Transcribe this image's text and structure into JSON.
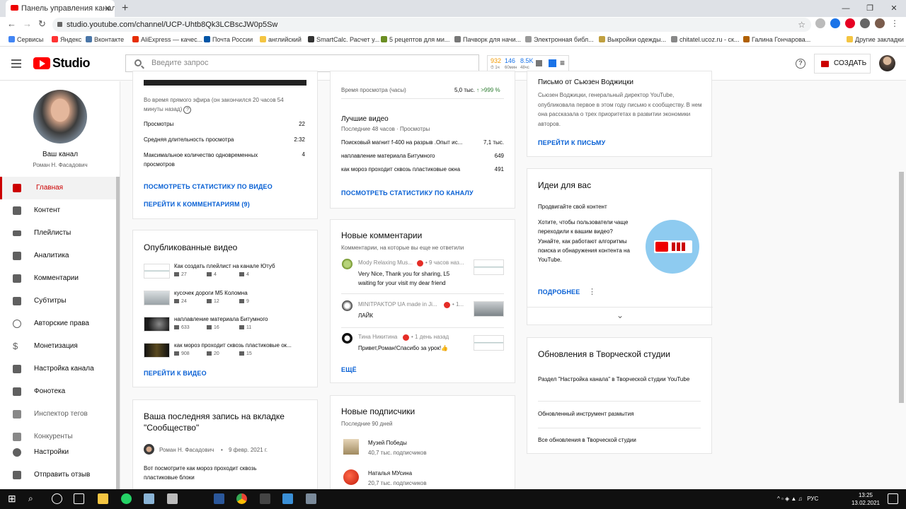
{
  "browser": {
    "tab_title": "Панель управления каналом - ",
    "tab_close": "✕",
    "new_tab": "+",
    "url": "studio.youtube.com/channel/UCP-Uhtb8Qk3LCBscJW0p5Sw",
    "window_controls": [
      "—",
      "❐",
      "✕"
    ],
    "bookmarks": [
      {
        "label": "Сервисы",
        "color": "#4285f4"
      },
      {
        "label": "Яндекс",
        "color": "#f33"
      },
      {
        "label": "Вконтакте",
        "color": "#4a76a8"
      },
      {
        "label": "AliExpress — качес...",
        "color": "#e62e04"
      },
      {
        "label": "Почта России",
        "color": "#0055a6"
      },
      {
        "label": "английский",
        "color": "#f4c542"
      },
      {
        "label": "SmartCalc. Расчет у...",
        "color": "#333"
      },
      {
        "label": "5 рецептов для ми...",
        "color": "#6b8e23"
      },
      {
        "label": "Пачворк для начи...",
        "color": "#777"
      },
      {
        "label": "Электронная библ...",
        "color": "#999"
      },
      {
        "label": "Выкройки одежды...",
        "color": "#c0a040"
      },
      {
        "label": "chitatel.ucoz.ru - ск...",
        "color": "#888"
      },
      {
        "label": "Галина Гончарова...",
        "color": "#b06000"
      },
      {
        "label": "Другие закладки",
        "color": "#f4c542"
      }
    ]
  },
  "header": {
    "logo_text": "Studio",
    "search_placeholder": "Введите запрос",
    "counters": [
      {
        "value": "932",
        "sub": "⏱ 1ч",
        "color": "#f29900"
      },
      {
        "value": "146",
        "sub": "60мин",
        "color": "#1a73e8"
      },
      {
        "value": "8.5K",
        "sub": "48чс",
        "color": "#1a73e8"
      }
    ],
    "help_icon": "?",
    "create_label": "СОЗДАТЬ"
  },
  "sidebar": {
    "channel_title": "Ваш канал",
    "channel_owner": "Роман Н. Фасадович",
    "items": [
      {
        "label": "Главная",
        "icon": "dashboard-icon",
        "active": true
      },
      {
        "label": "Контент",
        "icon": "content-icon"
      },
      {
        "label": "Плейлисты",
        "icon": "playlists-icon"
      },
      {
        "label": "Аналитика",
        "icon": "analytics-icon"
      },
      {
        "label": "Комментарии",
        "icon": "comments-icon"
      },
      {
        "label": "Субтитры",
        "icon": "subtitles-icon"
      },
      {
        "label": "Авторские права",
        "icon": "copyright-icon"
      },
      {
        "label": "Монетизация",
        "icon": "monetization-icon"
      },
      {
        "label": "Настройка канала",
        "icon": "customization-icon"
      },
      {
        "label": "Фонотека",
        "icon": "audio-library-icon"
      },
      {
        "label": "Инспектор тегов",
        "icon": "tag-inspector-icon",
        "grey": true
      },
      {
        "label": "Конкуренты",
        "icon": "competitors-icon",
        "grey": true
      },
      {
        "label": "Настройки",
        "icon": "settings-icon"
      },
      {
        "label": "Отправить отзыв",
        "icon": "feedback-icon"
      }
    ]
  },
  "live_card": {
    "note": "Во время прямого эфира (он закончился 20 часов 54 минуты назад)",
    "rows": [
      {
        "label": "Просмотры",
        "value": "22"
      },
      {
        "label": "Средняя длительность просмотра",
        "value": "2:32"
      },
      {
        "label": "Максимальное количество одновременных просмотров",
        "value": "4"
      }
    ],
    "link_stats": "ПОСМОТРЕТЬ СТАТИСТИКУ ПО ВИДЕО",
    "link_comments": "ПЕРЕЙТИ К КОММЕНТАРИЯМ (9)"
  },
  "published_card": {
    "title": "Опубликованные видео",
    "videos": [
      {
        "title": "Как создать плейлист на канале Ютуб",
        "views": "27",
        "comments": "4",
        "likes": "4"
      },
      {
        "title": "кусочек дороги М5 Коломна",
        "views": "24",
        "comments": "12",
        "likes": "9"
      },
      {
        "title": "наплавление материала Битумного",
        "views": "633",
        "comments": "16",
        "likes": "11"
      },
      {
        "title": "как мороз проходит сквозь пластиковые ок...",
        "views": "908",
        "comments": "20",
        "likes": "15"
      }
    ],
    "link": "ПЕРЕЙТИ К ВИДЕО"
  },
  "community_card": {
    "title": "Ваша последняя запись на вкладке \"Сообщество\"",
    "author": "Роман Н. Фасадович",
    "date": "9 февр. 2021 г.",
    "text": "Вот посмотрите как мороз проходит сквозь пластиковые блоки"
  },
  "analytics_card": {
    "watch_label": "Время просмотра (часы)",
    "watch_value": "5,0 тыс.",
    "watch_change": "↑ >999 %",
    "top_title": "Лучшие видео",
    "top_sub": "Последние 48 часов · Просмотры",
    "top_videos": [
      {
        "title": "Поисковый магнит f-400 на разрыв .Опыт ис...",
        "value": "7,1 тыс."
      },
      {
        "title": "наплавление материала Битумного",
        "value": "649"
      },
      {
        "title": "как мороз проходит сквозь пластиковые окна",
        "value": "491"
      }
    ],
    "link": "ПОСМОТРЕТЬ СТАТИСТИКУ ПО КАНАЛУ"
  },
  "comments_card": {
    "title": "Новые комментарии",
    "sub": "Комментарии, на которые вы еще не ответили",
    "comments": [
      {
        "author": "Mody Relaxing Mus...",
        "time": "• 9 часов наз...",
        "text": "Very Nice, Thank you for sharing, L5 waiting for your visit my dear friend"
      },
      {
        "author": "MINITPAKTOP UA made in Ji...",
        "time": "• 1...",
        "text": "ЛАЙК"
      },
      {
        "author": "Тина Никитина",
        "time": "• 1 день назад",
        "text": "Привет,Роман!Спасибо за урок!👍"
      }
    ],
    "link": "ЕЩЁ"
  },
  "subscribers_card": {
    "title": "Новые подписчики",
    "sub": "Последние 90 дней",
    "subs": [
      {
        "name": "Музей Победы",
        "count": "40,7 тыс. подписчиков"
      },
      {
        "name": "Наталья МУсина",
        "count": "20,7 тыс. подписчиков"
      }
    ]
  },
  "letter_card": {
    "title": "Письмо от Сьюзен Воджицки",
    "text": "Сьюзен Воджицки, генеральный директор YouTube, опубликовала первое в этом году письмо к сообществу. В нем она рассказала о трех приоритетах в развитии экономики авторов.",
    "link": "ПЕРЕЙТИ К ПИСЬМУ"
  },
  "ideas_card": {
    "title": "Идеи для вас",
    "subtitle": "Продвигайте свой контент",
    "text": "Хотите, чтобы пользователи чаще переходили к вашим видео? Узнайте, как работают алгоритмы поиска и обнаружения контента на YouTube.",
    "link": "ПОДРОБНЕЕ",
    "more_icon": "⋮",
    "expand_icon": "⌄"
  },
  "updates_card": {
    "title": "Обновления в Творческой студии",
    "items": [
      "Раздел \"Настройка канала\" в Творческой студии YouTube",
      "Обновленный инструмент размытия",
      "Все обновления в Творческой студии"
    ]
  },
  "taskbar": {
    "lang": "РУС",
    "time": "13:25",
    "date": "13.02.2021"
  }
}
